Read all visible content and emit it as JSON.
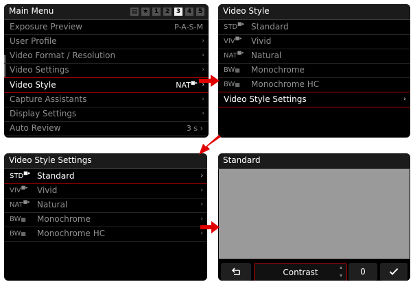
{
  "main_menu": {
    "title": "Main Menu",
    "tabs": [
      "▤",
      "★",
      "1",
      "2",
      "3",
      "4",
      "5"
    ],
    "active_tab": 4,
    "items": [
      {
        "label": "Exposure Preview",
        "value": "P-A-S-M"
      },
      {
        "label": "User Profile",
        "value": "›"
      },
      {
        "label": "Video Format / Resolution",
        "value": "›"
      },
      {
        "label": "Video Settings",
        "value": "›"
      },
      {
        "label": "Video Style",
        "value": "NAT",
        "active": true
      },
      {
        "label": "Capture Assistants",
        "value": "›"
      },
      {
        "label": "Display Settings",
        "value": "›"
      },
      {
        "label": "Auto Review",
        "value": "3 s ›"
      }
    ]
  },
  "video_style": {
    "title": "Video Style",
    "items": [
      {
        "code": "STD",
        "name": "Standard"
      },
      {
        "code": "VIV",
        "name": "Vivid"
      },
      {
        "code": "NAT",
        "name": "Natural"
      },
      {
        "code": "BW",
        "name": "Monochrome"
      },
      {
        "code": "BW",
        "name": "Monochrome HC"
      }
    ],
    "settings_label": "Video Style Settings"
  },
  "style_settings": {
    "title": "Video Style Settings",
    "items": [
      {
        "code": "STD",
        "name": "Standard",
        "active": true
      },
      {
        "code": "VIV",
        "name": "Vivid"
      },
      {
        "code": "NAT",
        "name": "Natural"
      },
      {
        "code": "BW",
        "name": "Monochrome"
      },
      {
        "code": "BW",
        "name": "Monochrome HC"
      }
    ]
  },
  "standard": {
    "title": "Standard",
    "back_icon": "back-arrow-icon",
    "parameter": "Contrast",
    "value": "0",
    "confirm_icon": "checkmark-icon"
  },
  "colors": {
    "accent_red": "#e10000",
    "panel": "#000000",
    "preview_gray": "#9a9a9a"
  }
}
